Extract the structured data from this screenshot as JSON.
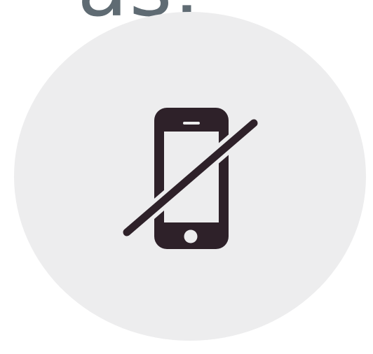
{
  "heading": {
    "visible_text": "as."
  },
  "badge": {
    "icon": "no-phone-icon",
    "background_color": "#ededee",
    "icon_color": "#2e2129"
  },
  "colors": {
    "heading_text": "#5f6b73",
    "page_background": "#ffffff"
  }
}
